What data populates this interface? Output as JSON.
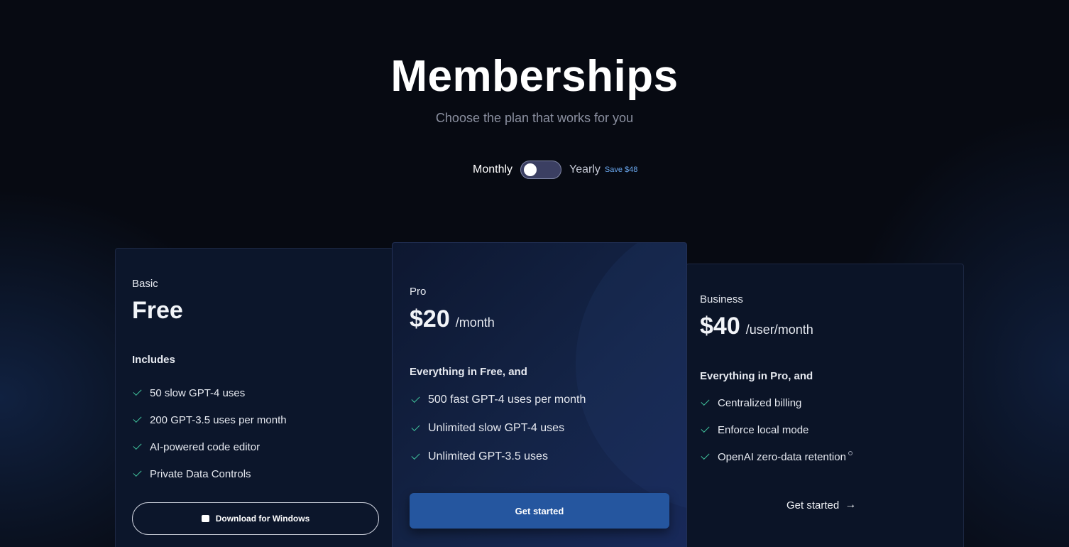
{
  "header": {
    "title": "Memberships",
    "subtitle": "Choose the plan that works for you"
  },
  "billing_toggle": {
    "monthly_label": "Monthly",
    "yearly_label": "Yearly",
    "save_badge": "Save $48",
    "selected": "Monthly"
  },
  "plans": [
    {
      "name": "Basic",
      "price": "Free",
      "price_unit": "",
      "features_heading": "Includes",
      "features": [
        "50 slow GPT-4 uses",
        "200 GPT-3.5 uses per month",
        "AI-powered code editor",
        "Private Data Controls"
      ],
      "cta_label": "Download for Windows"
    },
    {
      "name": "Pro",
      "price": "$20",
      "price_unit": "/month",
      "features_heading": "Everything in Free, and",
      "features": [
        "500 fast GPT-4 uses per month",
        "Unlimited slow GPT-4 uses",
        "Unlimited GPT-3.5 uses"
      ],
      "cta_label": "Get started"
    },
    {
      "name": "Business",
      "price": "$40",
      "price_unit": "/user/month",
      "features_heading": "Everything in Pro, and",
      "features": [
        "Centralized billing",
        "Enforce local mode",
        "OpenAI zero-data retention"
      ],
      "cta_label": "Get started"
    }
  ],
  "colors": {
    "background": "#070a12",
    "check": "#3fbf9a",
    "primary_button": "#25569f",
    "save_badge": "#6aa8f0"
  },
  "icons": {
    "check": "check-icon",
    "windows": "windows-icon",
    "arrow": "arrow-right-icon",
    "info": "info-icon"
  }
}
